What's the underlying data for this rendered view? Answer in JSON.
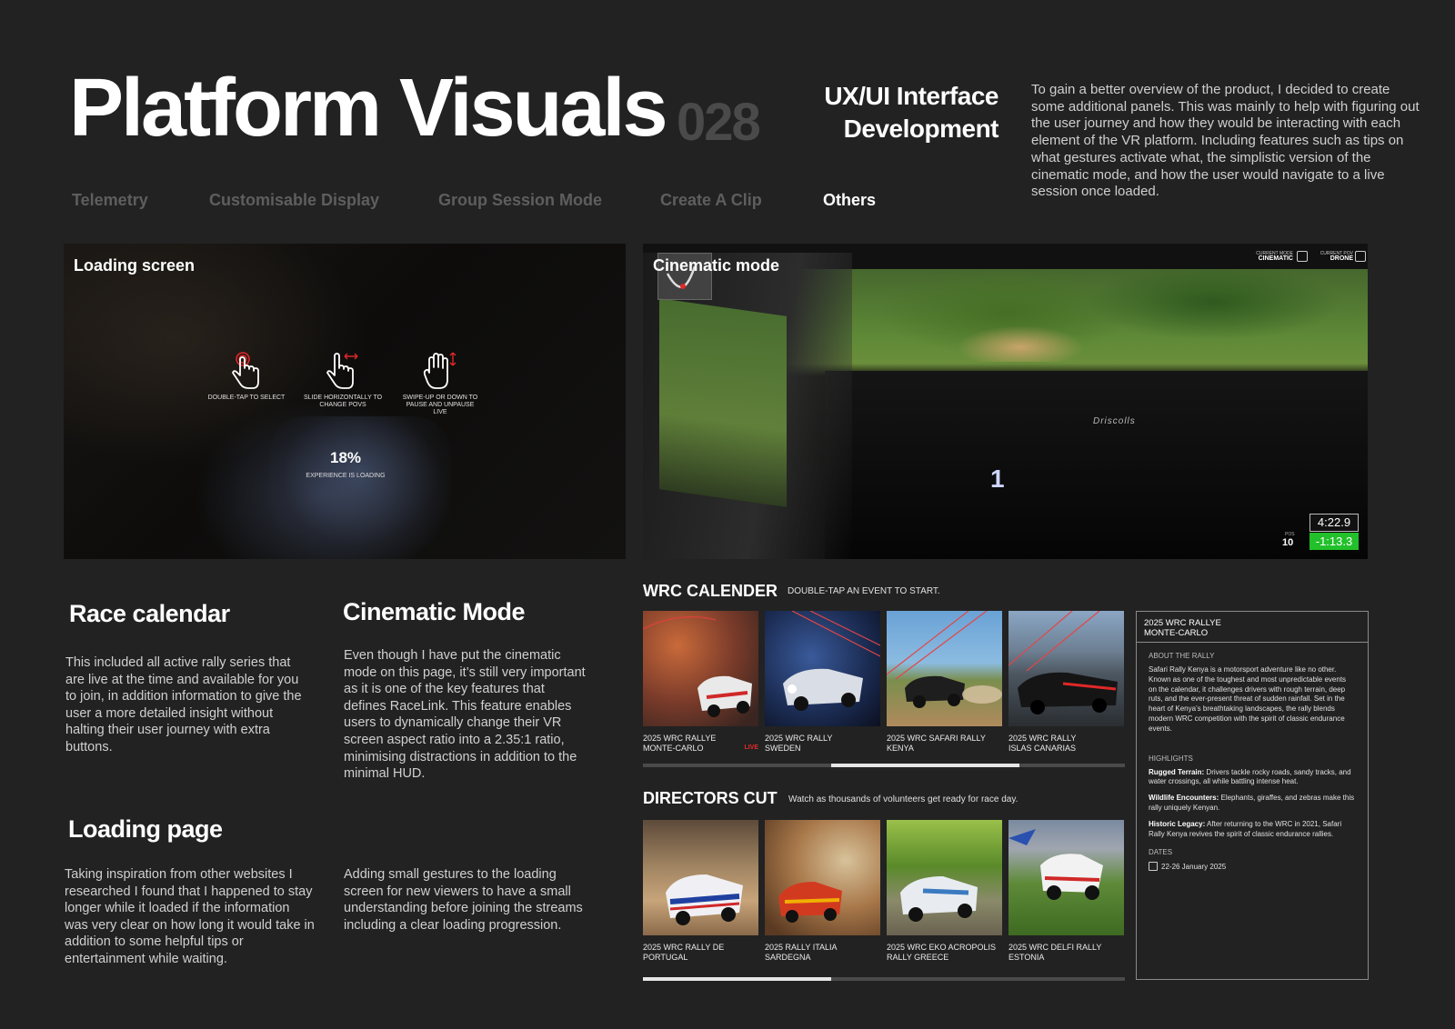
{
  "header": {
    "title": "Platform Visuals",
    "number": "028",
    "subtitle_line1": "UX/UI Interface",
    "subtitle_line2": "Development",
    "intro": "To gain a better overview of the product, I decided to create some additional panels. This was mainly to help with figuring out the user journey and how they would be interacting with each element of the VR platform. Including features such as tips on what gestures activate what, the simplistic version of the cinematic mode, and how the user would navigate to a live session once loaded."
  },
  "nav": {
    "tabs": [
      {
        "label": "Telemetry"
      },
      {
        "label": "Customisable Display"
      },
      {
        "label": "Group Session Mode"
      },
      {
        "label": "Create A Clip"
      },
      {
        "label": "Others"
      }
    ],
    "active_index": 4
  },
  "loading_panel": {
    "label": "Loading screen",
    "gestures": [
      {
        "icon": "double-tap-icon",
        "label": "DOUBLE-TAP TO SELECT"
      },
      {
        "icon": "slide-horizontal-icon",
        "label": "SLIDE HORIZONTALLY TO CHANGE POVS"
      },
      {
        "icon": "swipe-vertical-icon",
        "label": "SWIPE-UP OR DOWN TO PAUSE AND UNPAUSE LIVE"
      }
    ],
    "progress_percent": "18%",
    "progress_label": "EXPERIENCE IS LOADING",
    "accent": "#e02828"
  },
  "cinematic_panel": {
    "label": "Cinematic mode",
    "current_mode_caption": "CURRENT MODE",
    "current_mode_value": "CINEMATIC",
    "current_pov_caption": "CURRENT POV",
    "current_pov_value": "DRONE",
    "dash_brand": "Driscolls",
    "gear": "1",
    "pos_caption": "POS",
    "pos_value": "10",
    "time": "4:22.9",
    "delta": "-1:13.3",
    "delta_color": "#22c02a"
  },
  "sections": {
    "race_calendar_title": "Race calendar",
    "race_calendar_text": "This included all active rally series that are live at the time and available for you to join, in addition information to give the user a more detailed insight without halting their user journey with extra buttons.",
    "cinematic_title": "Cinematic Mode",
    "cinematic_text": "Even though I have put the cinematic mode on this page, it’s still very important as it is one of the key features that defines RaceLink. This feature enables users to dynamically change their VR screen aspect ratio into a 2.35:1 ratio, minimising distractions in addition to the minimal HUD.",
    "loading_title": "Loading page",
    "loading_text": "Taking inspiration from other websites I researched I found that I happened to stay longer while it loaded if the information was very clear on how long it would take in addition to some helpful tips or entertainment while waiting.",
    "gestures_text": "Adding small gestures to the loading screen for new viewers to have a small understanding before joining the streams including a clear loading progression."
  },
  "calendar": {
    "title": "WRC CALENDER",
    "hint": "DOUBLE-TAP AN EVENT TO START.",
    "live_label": "LIVE",
    "events": [
      {
        "line1": "2025 WRC RALLYE",
        "line2": "MONTE-CARLO"
      },
      {
        "line1": "2025 WRC RALLY",
        "line2": "SWEDEN"
      },
      {
        "line1": "2025 WRC SAFARI RALLY",
        "line2": "KENYA"
      },
      {
        "line1": "2025 WRC RALLY",
        "line2": "ISLAS CANARIAS"
      }
    ],
    "scroll_progress": 0.39
  },
  "directors_cut": {
    "title": "DIRECTORS CUT",
    "hint": "Watch as thousands of volunteers get ready for race day.",
    "events": [
      {
        "line1": "2025 WRC RALLY DE",
        "line2": "PORTUGAL"
      },
      {
        "line1": "2025 RALLY ITALIA",
        "line2": "SARDEGNA"
      },
      {
        "line1": "2025 WRC EKO ACROPOLIS",
        "line2": "RALLY GREECE"
      },
      {
        "line1": "2025 WRC DELFI RALLY",
        "line2": "ESTONIA"
      }
    ],
    "scroll_progress": 0.39
  },
  "info_panel": {
    "title_line1": "2025 WRC RALLYE",
    "title_line2": "MONTE-CARLO",
    "about_heading": "ABOUT THE RALLY",
    "about_text": "Safari Rally Kenya is a motorsport adventure like no other. Known as one of the toughest and most unpredictable events on the calendar, it challenges drivers with rough terrain, deep ruts, and the ever-present threat of sudden rainfall. Set in the heart of Kenya’s breathtaking landscapes, the rally blends modern WRC competition with the spirit of classic endurance events.",
    "highlights_heading": "HIGHLIGHTS",
    "highlights": [
      {
        "label": "Rugged Terrain:",
        "text": " Drivers tackle rocky roads, sandy tracks, and water crossings, all while battling intense heat."
      },
      {
        "label": "Wildlife Encounters:",
        "text": " Elephants, giraffes, and zebras make this rally uniquely Kenyan."
      },
      {
        "label": "Historic Legacy:",
        "text": " After returning to the WRC in 2021, Safari Rally Kenya revives the spirit of classic endurance rallies."
      }
    ],
    "dates_heading": "DATES",
    "dates_value": "22-26 January 2025"
  }
}
